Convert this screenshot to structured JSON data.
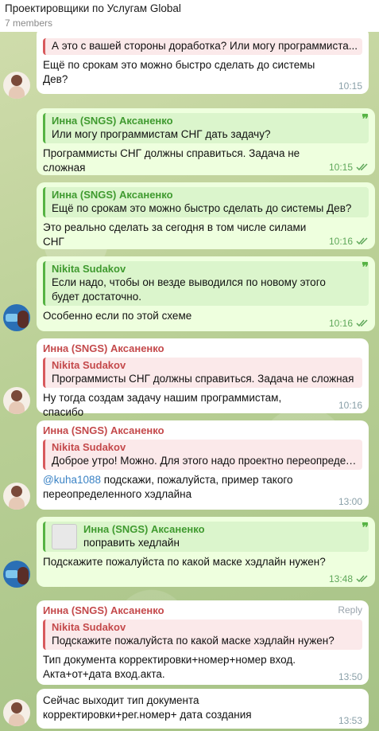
{
  "header": {
    "title": "Проектировщики по Услугам Global",
    "members": "7 members"
  },
  "messages": [
    {
      "reply_text": "А это с вашей стороны доработка? Или могу программиста...",
      "text": "Ещё по срокам это можно быстро сделать до системы Дев?",
      "time": "10:15"
    },
    {
      "reply_name": "Инна (SNGS) Аксаненко",
      "reply_text": "Или могу программистам СНГ дать задачу?",
      "text": "Программисты СНГ должны справиться. Задача не сложная",
      "time": "10:15"
    },
    {
      "reply_name": "Инна (SNGS) Аксаненко",
      "reply_text": "Ещё по срокам это можно быстро сделать до системы Дев?",
      "text": "Это реально сделать за сегодня в том числе силами СНГ",
      "time": "10:16"
    },
    {
      "reply_name": "Nikita Sudakov",
      "reply_text": "Если надо, чтобы он везде выводился по новому этого будет достаточно.",
      "text": "Особенно если по этой схеме",
      "time": "10:16"
    },
    {
      "sender": "Инна (SNGS) Аксаненко",
      "reply_name": "Nikita Sudakov",
      "reply_text": "Программисты СНГ должны справиться. Задача не сложная",
      "text": "Ну тогда создам задачу нашим программистам, спасибо",
      "time": "10:16"
    },
    {
      "sender": "Инна (SNGS) Аксаненко",
      "reply_name": "Nikita Sudakov",
      "reply_text": "Доброе утро!  Можно. Для этого надо проектно переопредел...",
      "mention": "@kuha1088",
      "text": " подскажи, пожалуйста, пример такого переопределенного хэдлайна",
      "time": "13:00"
    },
    {
      "reply_name": "Инна (SNGS) Аксаненко",
      "reply_text": "поправить  хедлайн",
      "text": "Подскажите пожалуйста по какой маске хэдлайн нужен?",
      "time": "13:48"
    },
    {
      "sender": "Инна (SNGS) Аксаненко",
      "reply_label": "Reply",
      "reply_name": "Nikita Sudakov",
      "reply_text": "Подскажите пожалуйста по какой маске хэдлайн нужен?",
      "text": "Тип документа корректировки+номер+номер вход. Акта+от+дата вход.акта.",
      "time": "13:50"
    },
    {
      "text": "Сейчас выходит тип документа корректировки+рег.номер+ дата создания",
      "time": "13:53"
    }
  ],
  "colors": {
    "incoming": "#ffffff",
    "outgoing": "#eeffde",
    "inna_name": "#c4494b",
    "nikita_name": "#3f9a2f",
    "mention": "#3b83c5"
  }
}
